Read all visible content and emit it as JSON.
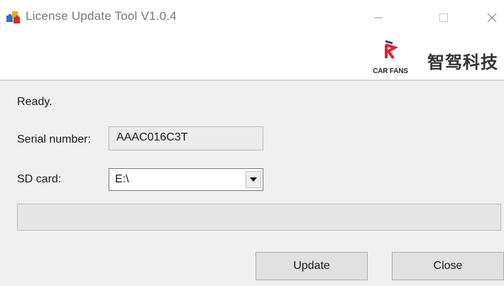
{
  "window": {
    "title": "License Update Tool V1.0.4",
    "icon": "puzzle-app-icon",
    "controls": {
      "minimize": "minimize-icon",
      "maximize": "maximize-icon",
      "close": "close-icon"
    }
  },
  "header": {
    "logo_text": "CAR FANS",
    "brand_name": "智驾科技",
    "logo_color": "#e8202a",
    "logo_accent": "#2b3a8c"
  },
  "main": {
    "status": "Ready.",
    "serial": {
      "label": "Serial number:",
      "value": "AAAC016C3T"
    },
    "sd_card": {
      "label": "SD card:",
      "value": "E:\\"
    },
    "progress": {
      "value": 0
    },
    "buttons": {
      "update": "Update",
      "close": "Close"
    }
  }
}
